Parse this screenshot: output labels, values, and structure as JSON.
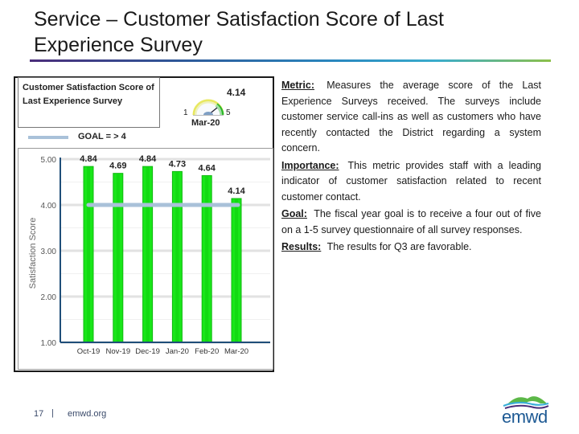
{
  "slide": {
    "title": "Service – Customer Satisfaction Score of Last Experience Survey",
    "page_number": "17",
    "separator": "|",
    "website": "emwd.org",
    "logo_text": "emwd"
  },
  "chart_panel": {
    "title": "Customer Satisfaction Score of Last Experience Survey",
    "gauge": {
      "value": "4.14",
      "value_num": 4.14,
      "min": "1",
      "max": "5",
      "label": "Mar-20"
    },
    "legend": {
      "goal_label": "GOAL = > 4",
      "goal_color": "#a9c1d9"
    }
  },
  "chart_data": {
    "type": "bar",
    "title": "Customer Satisfaction Score of Last Experience Survey",
    "xlabel": "",
    "ylabel": "Satisfaction Score",
    "categories": [
      "Oct-19",
      "Nov-19",
      "Dec-19",
      "Jan-20",
      "Feb-20",
      "Mar-20"
    ],
    "values": [
      4.84,
      4.69,
      4.84,
      4.73,
      4.64,
      4.14
    ],
    "data_labels": [
      "4.84",
      "4.69",
      "4.84",
      "4.73",
      "4.64",
      "4.14"
    ],
    "ylim": [
      1.0,
      5.0
    ],
    "yticks": [
      "1.00",
      "2.00",
      "3.00",
      "4.00",
      "5.00"
    ],
    "ytick_values": [
      1,
      2,
      3,
      4,
      5
    ],
    "grid": true,
    "goal_line": {
      "label": "GOAL = > 4",
      "value": 4.0
    },
    "bar_color": "#19e619",
    "bar_edge_color": "#0fb80f",
    "goal_color": "#a9c1d9",
    "axis_color": "#1f4e79",
    "legend_position": "top-left"
  },
  "description": {
    "metric_label": "Metric:",
    "metric_text": "Measures the average score of the Last Experience Surveys received. The surveys include customer service call-ins as well as customers who have recently contacted the District regarding a system concern.",
    "importance_label": "Importance:",
    "importance_text": "This metric provides staff with a leading indicator of customer satisfaction related to recent customer contact.",
    "goal_label": "Goal:",
    "goal_text": "The fiscal year goal is to receive a four out of five on a 1-5 survey questionnaire of all survey responses.",
    "results_label": "Results:",
    "results_text": "The results for Q3 are favorable."
  }
}
